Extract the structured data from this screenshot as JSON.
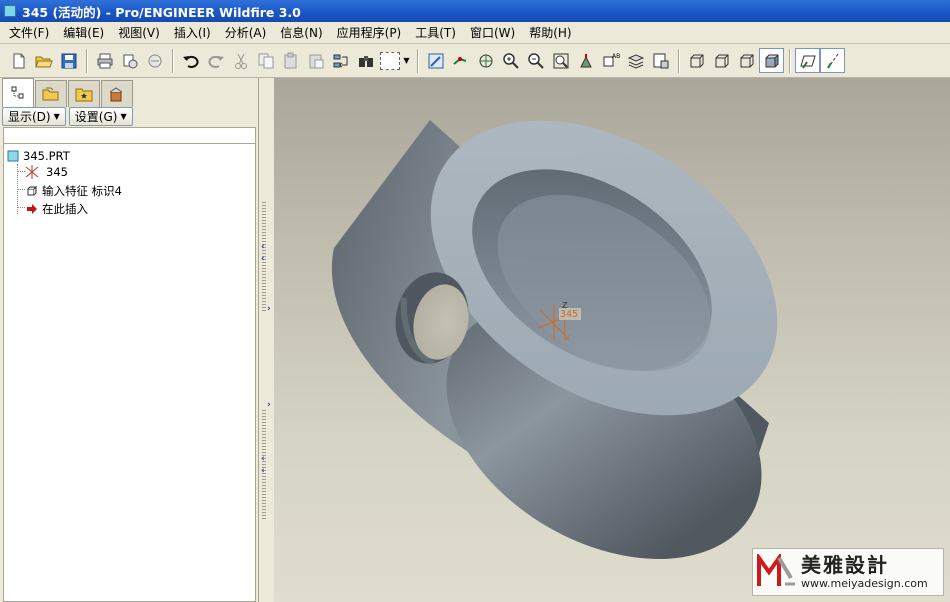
{
  "window": {
    "title": "345 (活动的) - Pro/ENGINEER Wildfire 3.0"
  },
  "menu": [
    {
      "label": "文件(F)"
    },
    {
      "label": "编辑(E)"
    },
    {
      "label": "视图(V)"
    },
    {
      "label": "插入(I)"
    },
    {
      "label": "分析(A)"
    },
    {
      "label": "信息(N)"
    },
    {
      "label": "应用程序(P)"
    },
    {
      "label": "工具(T)"
    },
    {
      "label": "窗口(W)"
    },
    {
      "label": "帮助(H)"
    }
  ],
  "panel": {
    "show_label": "显示(D)",
    "settings_label": "设置(G)"
  },
  "tree": {
    "root": "345.PRT",
    "items": [
      {
        "label": "345",
        "icon": "coordinate-system-icon"
      },
      {
        "label": "输入特征 标识4",
        "icon": "import-feature-icon"
      },
      {
        "label": "在此插入",
        "icon": "insert-arrow-icon"
      }
    ]
  },
  "viewport": {
    "csys": {
      "label": "345",
      "axis_z": "Z",
      "axis_x": "X",
      "color": "#d2691e"
    },
    "model_colors": {
      "top_face": "#a5b0b9",
      "side_dark": "#5b636b",
      "side_light": "#8c969f"
    }
  },
  "watermark": {
    "title": "美雅設計",
    "url": "www.meiyadesign.com",
    "logo_color": "#d0191b"
  },
  "colors": {
    "titlebar": "#1a55c4",
    "chrome": "#ece9d8"
  }
}
